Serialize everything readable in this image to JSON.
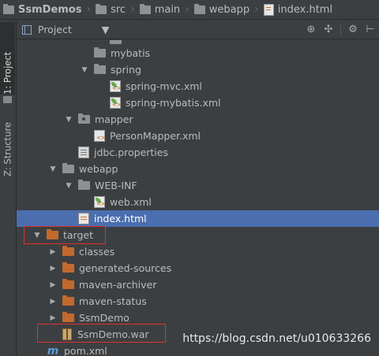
{
  "breadcrumb": {
    "items": [
      {
        "label": "SsmDemos",
        "bold": true
      },
      {
        "label": "src"
      },
      {
        "label": "main"
      },
      {
        "label": "webapp"
      },
      {
        "label": "index.html"
      }
    ]
  },
  "side_tabs": {
    "project": "1: Project",
    "structure": "Z: Structure"
  },
  "panel": {
    "title": "Project",
    "toolbar_icons": [
      "target-icon",
      "collapse-icon",
      "gear-icon",
      "hide-icon"
    ]
  },
  "tree": [
    {
      "label": "mybatis",
      "indent": 2,
      "arrow": "",
      "icon": "folder-gray"
    },
    {
      "label": "spring",
      "indent": 2,
      "arrow": "down",
      "icon": "folder-gray"
    },
    {
      "label": "spring-mvc.xml",
      "indent": 3,
      "arrow": "",
      "icon": "spring-xml"
    },
    {
      "label": "spring-mybatis.xml",
      "indent": 3,
      "arrow": "",
      "icon": "spring-xml"
    },
    {
      "label": "mapper",
      "indent": 1,
      "arrow": "down",
      "icon": "folder-package"
    },
    {
      "label": "PersonMapper.xml",
      "indent": 2,
      "arrow": "",
      "icon": "xml"
    },
    {
      "label": "jdbc.properties",
      "indent": 1,
      "arrow": "",
      "icon": "properties"
    },
    {
      "label": "webapp",
      "indent": 0,
      "arrow": "down",
      "icon": "folder-gray"
    },
    {
      "label": "WEB-INF",
      "indent": 1,
      "arrow": "down",
      "icon": "folder-gray"
    },
    {
      "label": "web.xml",
      "indent": 2,
      "arrow": "",
      "icon": "spring-xml"
    },
    {
      "label": "index.html",
      "indent": 1,
      "arrow": "",
      "icon": "html",
      "selected": true
    },
    {
      "label": "target",
      "indent": -1,
      "arrow": "down",
      "icon": "folder-orange"
    },
    {
      "label": "classes",
      "indent": 0,
      "arrow": "right",
      "icon": "folder-orange"
    },
    {
      "label": "generated-sources",
      "indent": 0,
      "arrow": "right",
      "icon": "folder-orange"
    },
    {
      "label": "maven-archiver",
      "indent": 0,
      "arrow": "right",
      "icon": "folder-orange"
    },
    {
      "label": "maven-status",
      "indent": 0,
      "arrow": "right",
      "icon": "folder-orange"
    },
    {
      "label": "SsmDemo",
      "indent": 0,
      "arrow": "right",
      "icon": "folder-orange"
    },
    {
      "label": "SsmDemo.war",
      "indent": 0,
      "arrow": "",
      "icon": "war"
    },
    {
      "label": "pom.xml",
      "indent": -1,
      "arrow": "",
      "icon": "maven"
    }
  ],
  "watermark": "https://blog.csdn.net/u010633266",
  "colors": {
    "selection": "#4b6eaf",
    "highlight_box": "#e03030",
    "excluded_folder": "#c2692e"
  }
}
